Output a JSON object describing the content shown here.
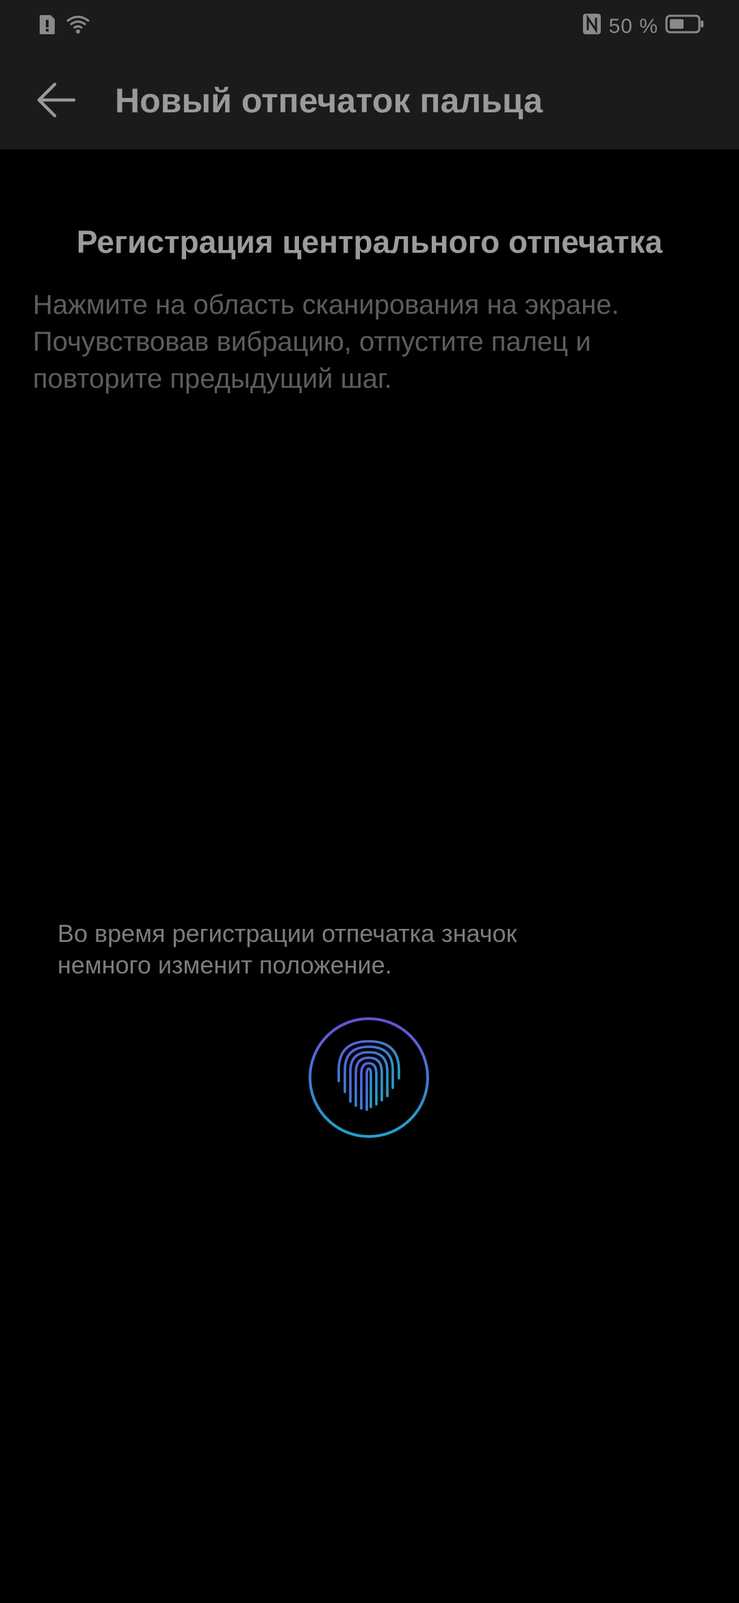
{
  "status_bar": {
    "battery_percent": "50 %",
    "icons": [
      "alert-icon",
      "wifi-icon",
      "nfc-icon",
      "battery-icon"
    ]
  },
  "app_bar": {
    "back_icon": "arrow-left-icon",
    "title": "Новый отпечаток пальца"
  },
  "content": {
    "heading": "Регистрация центрального отпечатка",
    "instructions": [
      "Нажмите на область сканирования на экране.",
      "Почувствовав вибрацию, отпустите палец и",
      "повторите предыдущий шаг."
    ],
    "hint": [
      "Во время регистрации отпечатка значок",
      "немного изменит положение."
    ],
    "sensor_icon": "fingerprint-icon"
  },
  "colors": {
    "background": "#000000",
    "bar_background": "#1b1b1b",
    "ring_gradient_start": "#6a4fd8",
    "ring_gradient_end": "#1fa3c9"
  }
}
